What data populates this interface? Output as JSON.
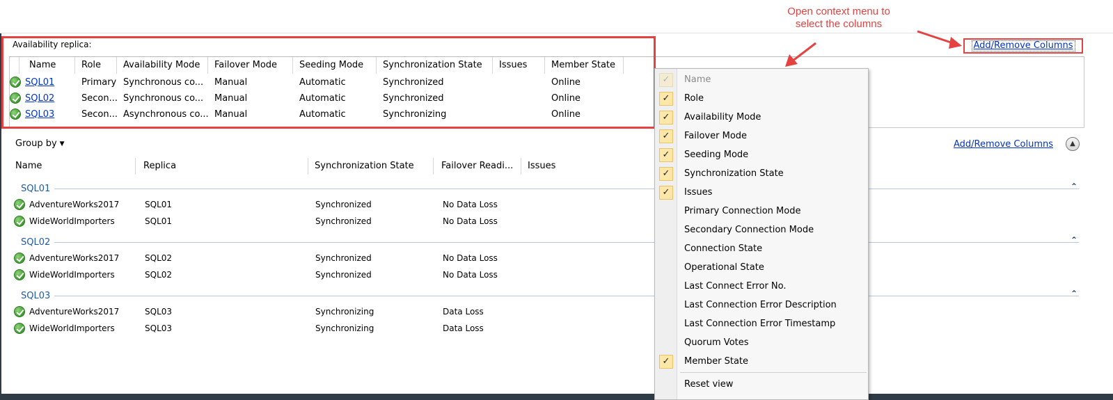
{
  "annotation": {
    "line1": "Open context menu to",
    "line2": "select the columns",
    "color": "#e64141"
  },
  "availability_replica": {
    "label": "Availability replica:",
    "columns": [
      "Name",
      "Role",
      "Availability Mode",
      "Failover Mode",
      "Seeding Mode",
      "Synchronization State",
      "Issues",
      "Member State"
    ],
    "rows": [
      {
        "name": "SQL01",
        "role": "Primary",
        "availability_mode": "Synchronous co...",
        "failover_mode": "Manual",
        "seeding_mode": "Automatic",
        "sync_state": "Synchronized",
        "issues": "",
        "member_state": "Online"
      },
      {
        "name": "SQL02",
        "role": "Secon...",
        "availability_mode": "Synchronous co...",
        "failover_mode": "Manual",
        "seeding_mode": "Automatic",
        "sync_state": "Synchronized",
        "issues": "",
        "member_state": "Online"
      },
      {
        "name": "SQL03",
        "role": "Secon...",
        "availability_mode": "Asynchronous co...",
        "failover_mode": "Manual",
        "seeding_mode": "Automatic",
        "sync_state": "Synchronizing",
        "issues": "",
        "member_state": "Online"
      }
    ]
  },
  "top_link": "Add/Remove Columns",
  "group_by": "Group by",
  "second_link": "Add/Remove Columns",
  "databases": {
    "columns": [
      "Name",
      "Replica",
      "Synchronization State",
      "Failover Readi...",
      "Issues"
    ],
    "groups": [
      {
        "name": "SQL01",
        "rows": [
          {
            "name": "AdventureWorks2017",
            "replica": "SQL01",
            "sync_state": "Synchronized",
            "failover": "No Data Loss"
          },
          {
            "name": "WideWorldImporters",
            "replica": "SQL01",
            "sync_state": "Synchronized",
            "failover": "No Data Loss"
          }
        ]
      },
      {
        "name": "SQL02",
        "rows": [
          {
            "name": "AdventureWorks2017",
            "replica": "SQL02",
            "sync_state": "Synchronized",
            "failover": "No Data Loss"
          },
          {
            "name": "WideWorldImporters",
            "replica": "SQL02",
            "sync_state": "Synchronized",
            "failover": "No Data Loss"
          }
        ]
      },
      {
        "name": "SQL03",
        "rows": [
          {
            "name": "AdventureWorks2017",
            "replica": "SQL03",
            "sync_state": "Synchronizing",
            "failover": "Data Loss"
          },
          {
            "name": "WideWorldImporters",
            "replica": "SQL03",
            "sync_state": "Synchronizing",
            "failover": "Data Loss"
          }
        ]
      }
    ]
  },
  "context_menu": {
    "items": [
      {
        "label": "Name",
        "checked": true,
        "disabled": true
      },
      {
        "label": "Role",
        "checked": true,
        "disabled": false
      },
      {
        "label": "Availability Mode",
        "checked": true,
        "disabled": false
      },
      {
        "label": "Failover Mode",
        "checked": true,
        "disabled": false
      },
      {
        "label": "Seeding Mode",
        "checked": true,
        "disabled": false
      },
      {
        "label": "Synchronization State",
        "checked": true,
        "disabled": false
      },
      {
        "label": "Issues",
        "checked": true,
        "disabled": false
      },
      {
        "label": "Primary Connection Mode",
        "checked": false,
        "disabled": false
      },
      {
        "label": "Secondary Connection Mode",
        "checked": false,
        "disabled": false
      },
      {
        "label": "Connection State",
        "checked": false,
        "disabled": false
      },
      {
        "label": "Operational State",
        "checked": false,
        "disabled": false
      },
      {
        "label": "Last Connect Error No.",
        "checked": false,
        "disabled": false
      },
      {
        "label": "Last Connection Error Description",
        "checked": false,
        "disabled": false
      },
      {
        "label": "Last Connection Error Timestamp",
        "checked": false,
        "disabled": false
      },
      {
        "label": "Quorum Votes",
        "checked": false,
        "disabled": false
      },
      {
        "label": "Member State",
        "checked": true,
        "disabled": false
      }
    ],
    "reset": "Reset view"
  }
}
